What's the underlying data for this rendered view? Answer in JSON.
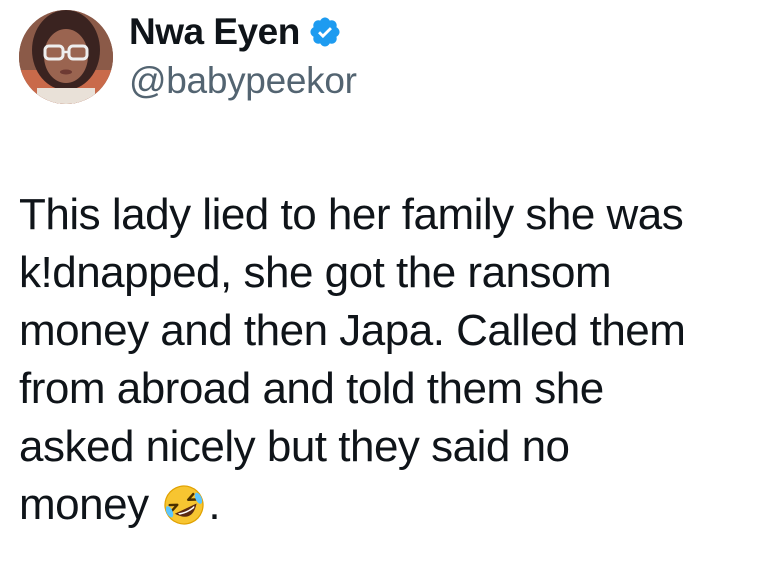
{
  "tweet": {
    "author": {
      "display_name": "Nwa Eyen",
      "handle": "@babypeekor",
      "verified": true,
      "avatar_icon": "profile-photo-woman-glasses"
    },
    "text_lines": [
      "This lady lied to her family she was",
      "k!dnapped, she got the ransom",
      "money and then Japa. Called them",
      "from abroad and told them she",
      "asked nicely but they said no",
      "money"
    ],
    "emoji": "rolling-on-floor-laughing-icon",
    "trailing_punctuation": ".",
    "colors": {
      "text": "#0f1419",
      "handle": "#536471",
      "verified_badge": "#1d9bf0"
    }
  }
}
